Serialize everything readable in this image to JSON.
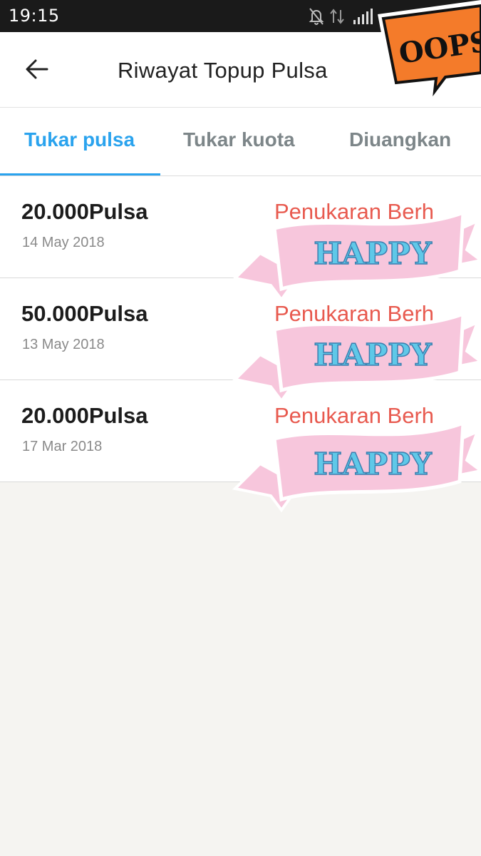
{
  "status_bar": {
    "time": "19:15",
    "icons": [
      "notifications-off-icon",
      "data-transfer-icon",
      "signal-icon"
    ]
  },
  "header": {
    "title": "Riwayat Topup Pulsa",
    "back_icon": "back-arrow-icon"
  },
  "tabs": [
    {
      "label": "Tukar pulsa",
      "active": true
    },
    {
      "label": "Tukar kuota",
      "active": false
    },
    {
      "label": "Diuangkan",
      "active": false
    }
  ],
  "history": [
    {
      "amount": "20.000Pulsa",
      "date": "14 May 2018",
      "status": "Penukaran Berh"
    },
    {
      "amount": "50.000Pulsa",
      "date": "13 May 2018",
      "status": "Penukaran Berh"
    },
    {
      "amount": "20.000Pulsa",
      "date": "17 Mar 2018",
      "status": "Penukaran Berh"
    }
  ],
  "stickers": {
    "ribbon_text": "HAPPY",
    "oops_text": "OOPS"
  },
  "colors": {
    "accent": "#2aa3ee",
    "status_text": "#e85a4f",
    "ribbon_pink": "#f7c6dc",
    "ribbon_text": "#5fc8e8",
    "oops_orange": "#f47b2a"
  }
}
